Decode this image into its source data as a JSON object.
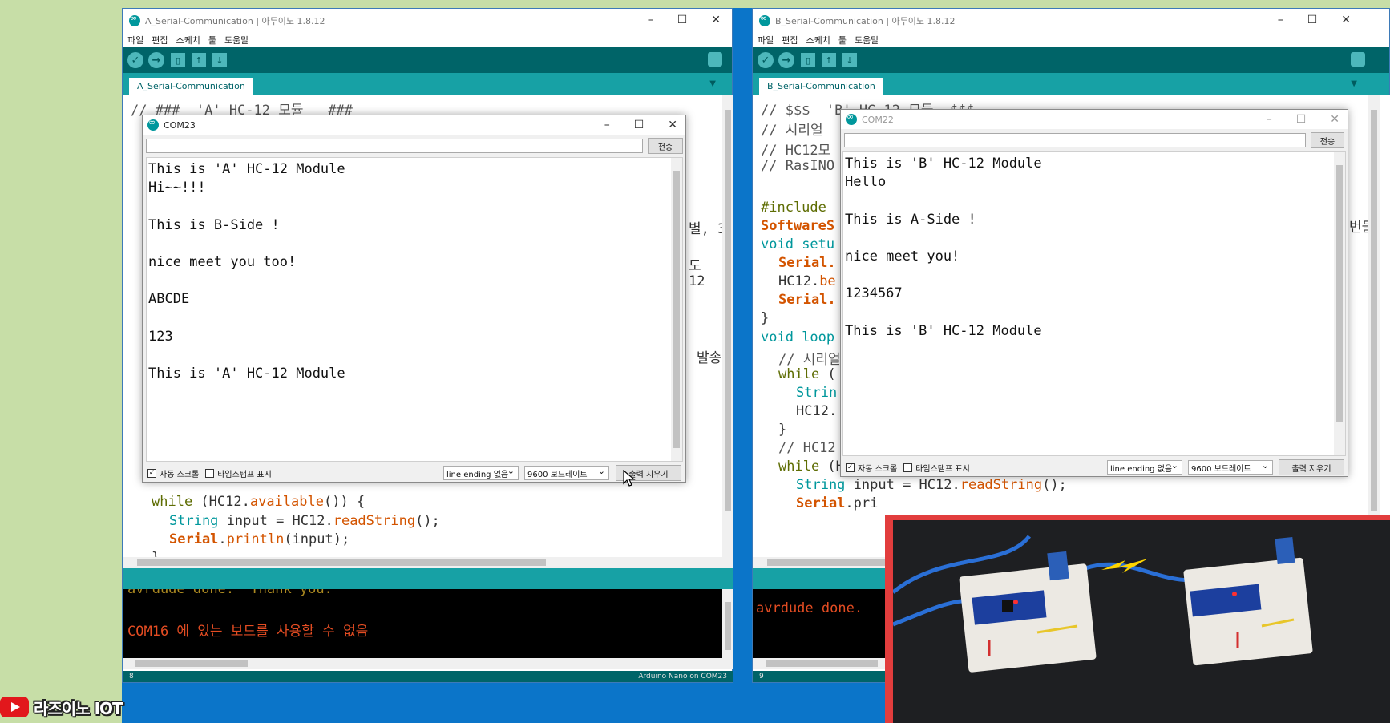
{
  "desktop": {
    "channel_name": "라즈이노 IOT"
  },
  "window_a": {
    "title": "A_Serial-Communication | 아두이노 1.8.12",
    "menu": [
      "파일",
      "편집",
      "스케치",
      "툴",
      "도움말"
    ],
    "tab_label": "A_Serial-Communication",
    "code": {
      "l1": "// ###  'A' HC-12 모듈   ###",
      "l_setup_tail": "별, 3",
      "l_do": "도",
      "l_12": "12",
      "l_send": "발송",
      "while_kw": "while",
      "while_rest": " (HC12.",
      "while_fn": "available",
      "while_end": "()) {",
      "str_kw": "String",
      "str_rest": " input = HC12.",
      "str_fn": "readString",
      "str_end": "();",
      "ser_kw": "Serial",
      "ser_rest": ".",
      "ser_fn": "println",
      "ser_end": "(input);",
      "brace_close": "}"
    },
    "console": {
      "line1": "avrdude done.  Thank you.",
      "line2": "COM16 에 있는 보드를 사용할 수 없음"
    },
    "status_line": "8",
    "status_board": "Arduino Nano on COM23"
  },
  "window_b": {
    "title": "B_Serial-Communication | 아두이노 1.8.12",
    "menu": [
      "파일",
      "편집",
      "스케치",
      "툴",
      "도움말"
    ],
    "tab_label": "B_Serial-Communication",
    "code": {
      "l1": "// $$$  'B' HC-12 모듈  $$$",
      "l2": "// 시리얼",
      "l3": "// HC12모",
      "l4": "// RasINO",
      "include": "#include",
      "swser": "SoftwareS",
      "void_kw": "void",
      "setup": " setu",
      "serial1": "Serial.",
      "hc12be_a": "HC12.",
      "hc12be_b": "be",
      "serial2": "Serial.",
      "brace": "}",
      "loop": " loop",
      "comment_serial": "// 시리얼",
      "while1": "while",
      "while1_rest": " (",
      "strin": "Strin",
      "hc12_line": "HC12.",
      "brace2": "}",
      "comment_hc12": "// HC12",
      "while2": "while",
      "while2_rest": " (HC12.",
      "while2_fn": "available",
      "while2_end": "()) {",
      "str_kw": "String",
      "str_rest": " input = HC12.",
      "str_fn": "readString",
      "str_end": "();",
      "ser_kw": "Serial",
      "ser_rest": ".pri",
      "side_text": "번들"
    },
    "console": {
      "line1": "avrdude done."
    },
    "status_line": "9"
  },
  "monitor_a": {
    "title": "COM23",
    "send_label": "전송",
    "lines": [
      "This is 'A' HC-12 Module",
      "Hi~~!!!",
      "",
      "This is B-Side !",
      "",
      "nice meet you too!",
      "",
      "ABCDE",
      "",
      "123",
      "",
      "This is 'A' HC-12 Module"
    ],
    "autoscroll_label": "자동 스크롤",
    "timestamp_label": "타임스탬프 표시",
    "line_ending": "line ending 없음",
    "baud": "9600 보드레이트",
    "clear_label": "출력 지우기"
  },
  "monitor_b": {
    "title": "COM22",
    "send_label": "전송",
    "lines": [
      "This is 'B' HC-12 Module",
      "Hello",
      "",
      "This is A-Side !",
      "",
      "nice meet you!",
      "",
      "1234567",
      "",
      "This is 'B' HC-12 Module"
    ],
    "autoscroll_label": "자동 스크롤",
    "timestamp_label": "타임스탬프 표시",
    "line_ending": "line ending 없음",
    "baud": "9600 보드레이트",
    "clear_label": "출력 지우기"
  },
  "colors": {
    "toolbar": "#006468",
    "tabbar": "#17a1a5",
    "keyword_orange": "#d35400",
    "keyword_teal": "#00979c",
    "console_text": "#e34c22",
    "photo_frame": "#e23d3d"
  }
}
